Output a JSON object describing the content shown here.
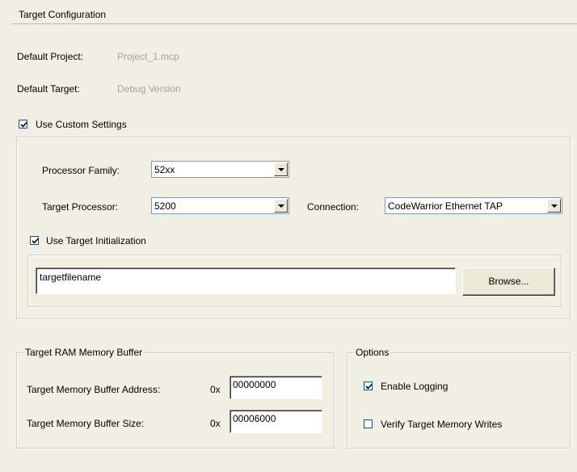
{
  "panel": {
    "title": "Target Configuration"
  },
  "defaults": {
    "project_label": "Default Project:",
    "project_value": "Project_1.mcp",
    "target_label": "Default Target:",
    "target_value": "Debug Version"
  },
  "custom_settings": {
    "label": "Use Custom Settings",
    "checked": true,
    "processor_family_label": "Processor Family:",
    "processor_family_value": "52xx",
    "target_processor_label": "Target Processor:",
    "target_processor_value": "5200",
    "connection_label": "Connection:",
    "connection_value": "CodeWarrior Ethernet TAP",
    "use_target_init_label": "Use Target Initialization",
    "use_target_init_checked": true,
    "init_filename": "targetfilename",
    "browse_label": "Browse..."
  },
  "ram_buffer": {
    "legend": "Target RAM Memory Buffer",
    "address_label": "Target Memory Buffer Address:",
    "address_prefix": "0x",
    "address_value": "00000000",
    "size_label": "Target Memory Buffer Size:",
    "size_prefix": "0x",
    "size_value": "00006000"
  },
  "options": {
    "legend": "Options",
    "enable_logging_label": "Enable Logging",
    "enable_logging_checked": true,
    "verify_writes_label": "Verify Target Memory Writes",
    "verify_writes_checked": false
  },
  "colors": {
    "background": "#f1efe4",
    "disabled_text": "#a6a49a",
    "checkbox_border": "#1c5180",
    "combo_border": "#7f9db9"
  }
}
